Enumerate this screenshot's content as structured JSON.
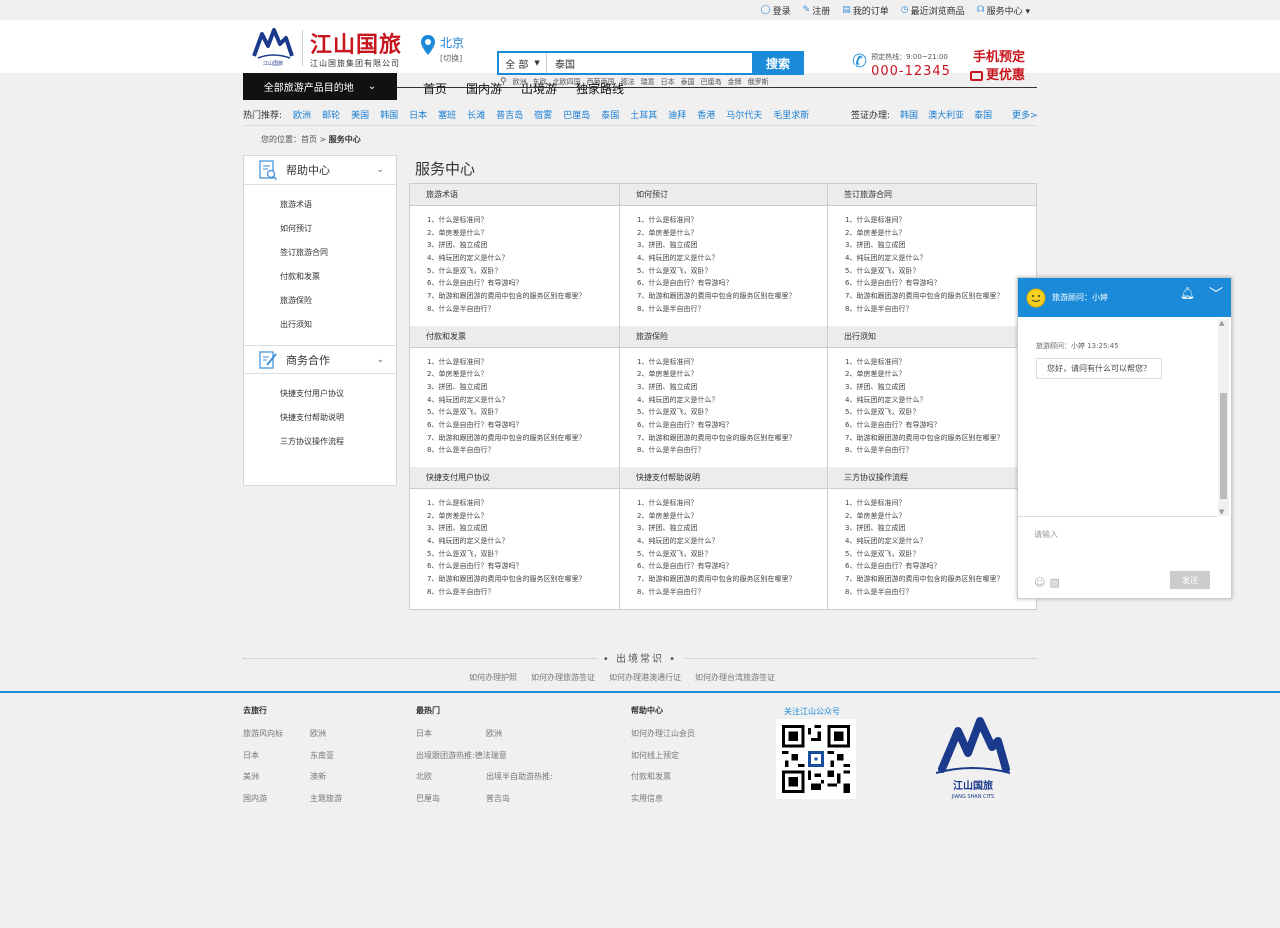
{
  "toplinks": {
    "login": "登录",
    "register": "注册",
    "orders": "我的订单",
    "recent": "最近浏览商品",
    "service": "服务中心 ▾"
  },
  "logo": {
    "cn": "江山国旅",
    "sub": "江山国旅集团有限公司",
    "mini": "江山国旅"
  },
  "city": {
    "name": "北京",
    "switch": "[切换]"
  },
  "search": {
    "scope": "全 部",
    "value": "泰国",
    "button": "搜索",
    "hotkeys": [
      "欧洲",
      "东欧",
      "北欧四国",
      "西葡两国",
      "德法",
      "瑞意",
      "日本",
      "泰国",
      "巴厘岛",
      "金牌",
      "俄罗斯"
    ]
  },
  "hotline": {
    "time": "预定热线：9:00~21:00",
    "number": "000-12345"
  },
  "mobile": {
    "line1": "手机预定",
    "line2": "更优惠"
  },
  "nav": {
    "all": "全部旅游产品目的地",
    "items": [
      "首页",
      "国内游",
      "出境游",
      "独家路线"
    ]
  },
  "hotrec": {
    "label": "热门推荐:",
    "items": [
      "欧洲",
      "邮轮",
      "美国",
      "韩国",
      "日本",
      "塞班",
      "长滩",
      "普吉岛",
      "宿雾",
      "巴厘岛",
      "泰国",
      "土耳其",
      "迪拜",
      "香港",
      "马尔代夫",
      "毛里求斯"
    ],
    "visa_label": "签证办理:",
    "visa": [
      "韩国",
      "澳大利亚",
      "泰国"
    ],
    "more": "更多>"
  },
  "crumb": {
    "label": "您的位置：",
    "home": "首页",
    "sep": " > ",
    "current": "服务中心"
  },
  "side": {
    "help_title": "帮助中心",
    "help_items": [
      "旅游术语",
      "如何预订",
      "签订旅游合同",
      "付款和发票",
      "旅游保险",
      "出行须知"
    ],
    "biz_title": "商务合作",
    "biz_items": [
      "快捷支付用户协议",
      "快捷支付帮助说明",
      "三方协议操作流程"
    ]
  },
  "main": {
    "title": "服务中心",
    "sections": [
      {
        "title": "旅游术语",
        "items": [
          "1、什么是标准间？",
          "2、单房差是什么？",
          "3、拼团、独立成团",
          "4、纯玩团的定义是什么？",
          "5、什么是双飞，双卧？",
          "6、什么是自由行？有导游吗？",
          "7、助游和跟团游的费用中包含的服务区别在哪里？",
          "8、什么是半自由行？"
        ]
      },
      {
        "title": "如何预订",
        "items": [
          "1、什么是标准间？",
          "2、单房差是什么？",
          "3、拼团、独立成团",
          "4、纯玩团的定义是什么？",
          "5、什么是双飞，双卧？",
          "6、什么是自由行？有导游吗？",
          "7、助游和跟团游的费用中包含的服务区别在哪里？",
          "8、什么是半自由行？"
        ]
      },
      {
        "title": "签订旅游合同",
        "items": [
          "1、什么是标准间？",
          "2、单房差是什么？",
          "3、拼团、独立成团",
          "4、纯玩团的定义是什么？",
          "5、什么是双飞，双卧？",
          "6、什么是自由行？有导游吗？",
          "7、助游和跟团游的费用中包含的服务区别在哪里？",
          "8、什么是半自由行？"
        ]
      },
      {
        "title": "付款和发票",
        "items": [
          "1、什么是标准间？",
          "2、单房差是什么？",
          "3、拼团、独立成团",
          "4、纯玩团的定义是什么？",
          "5、什么是双飞，双卧？",
          "6、什么是自由行？有导游吗？",
          "7、助游和跟团游的费用中包含的服务区别在哪里？",
          "8、什么是半自由行？"
        ]
      },
      {
        "title": "旅游保险",
        "items": [
          "1、什么是标准间？",
          "2、单房差是什么？",
          "3、拼团、独立成团",
          "4、纯玩团的定义是什么？",
          "5、什么是双飞，双卧？",
          "6、什么是自由行？有导游吗？",
          "7、助游和跟团游的费用中包含的服务区别在哪里？",
          "8、什么是半自由行？"
        ]
      },
      {
        "title": "出行须知",
        "items": [
          "1、什么是标准间？",
          "2、单房差是什么？",
          "3、拼团、独立成团",
          "4、纯玩团的定义是什么？",
          "5、什么是双飞，双卧？",
          "6、什么是自由行？有导游吗？",
          "7、助游和跟团游的费用中包含的服务区别在哪里？",
          "8、什么是半自由行？"
        ]
      },
      {
        "title": "快捷支付用户协议",
        "items": [
          "1、什么是标准间？",
          "2、单房差是什么？",
          "3、拼团、独立成团",
          "4、纯玩团的定义是什么？",
          "5、什么是双飞，双卧？",
          "6、什么是自由行？有导游吗？",
          "7、助游和跟团游的费用中包含的服务区别在哪里？",
          "8、什么是半自由行？"
        ]
      },
      {
        "title": "快捷支付帮助说明",
        "items": [
          "1、什么是标准间？",
          "2、单房差是什么？",
          "3、拼团、独立成团",
          "4、纯玩团的定义是什么？",
          "5、什么是双飞，双卧？",
          "6、什么是自由行？有导游吗？",
          "7、助游和跟团游的费用中包含的服务区别在哪里？",
          "8、什么是半自由行？"
        ]
      },
      {
        "title": "三方协议操作流程",
        "items": [
          "1、什么是标准间？",
          "2、单房差是什么？",
          "3、拼团、独立成团",
          "4、纯玩团的定义是什么？",
          "5、什么是双飞，双卧？",
          "6、什么是自由行？有导游吗？",
          "7、助游和跟团游的费用中包含的服务区别在哪里？",
          "8、什么是半自由行？"
        ]
      }
    ]
  },
  "chat": {
    "title": "旅游顾问：小婷",
    "meta": "旅游顾问：小婷     13:25:45",
    "greeting": "您好，请问有什么可以帮您？",
    "placeholder": "请输入",
    "send": "发送"
  },
  "knowledge": {
    "title": "• 出境常识 •",
    "links": [
      "如何办理护照",
      "如何办理旅游签证",
      "如何办理港澳通行证",
      "如何办理台湾旅游签证"
    ]
  },
  "footer": {
    "col1": {
      "title": "去旅行",
      "rows": [
        [
          "旅游风向标",
          "欧洲"
        ],
        [
          "日本",
          "东南亚"
        ],
        [
          "美洲",
          "澳新"
        ],
        [
          "国内游",
          "主题旅游"
        ]
      ]
    },
    "col2": {
      "title": "最热门",
      "rows": [
        [
          "日本",
          "欧洲"
        ],
        [
          "出境跟团游热推:",
          "德法瑞意"
        ],
        [
          "北欧",
          "出境半自助游热推:"
        ],
        [
          "巴厘岛",
          "普吉岛"
        ]
      ]
    },
    "col3": {
      "title": "帮助中心",
      "rows": [
        "如何办理江山会员",
        "如何线上预定",
        "付款和发票",
        "实用信息"
      ]
    },
    "follow": "关注江山公众号",
    "brand_en": "JIANG SHAN CITS"
  }
}
